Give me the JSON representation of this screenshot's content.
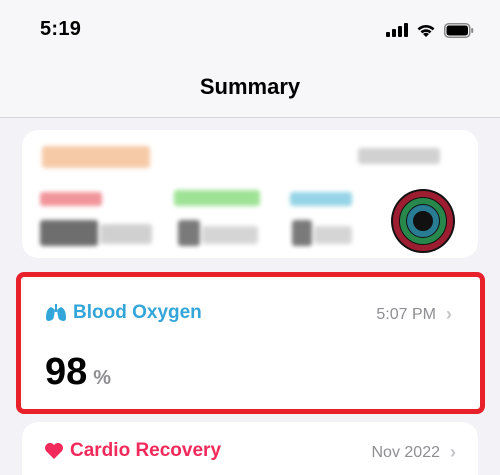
{
  "status_bar": {
    "time": "5:19"
  },
  "nav": {
    "title": "Summary"
  },
  "activity_card": {},
  "blood_oxygen": {
    "title": "Blood Oxygen",
    "time": "5:07 PM",
    "value": "98",
    "unit": "%",
    "color": "#32a5d9",
    "highlight_color": "#e8202a"
  },
  "cardio_recovery": {
    "title": "Cardio Recovery",
    "date": "Nov 2022",
    "color": "#f2295b"
  }
}
